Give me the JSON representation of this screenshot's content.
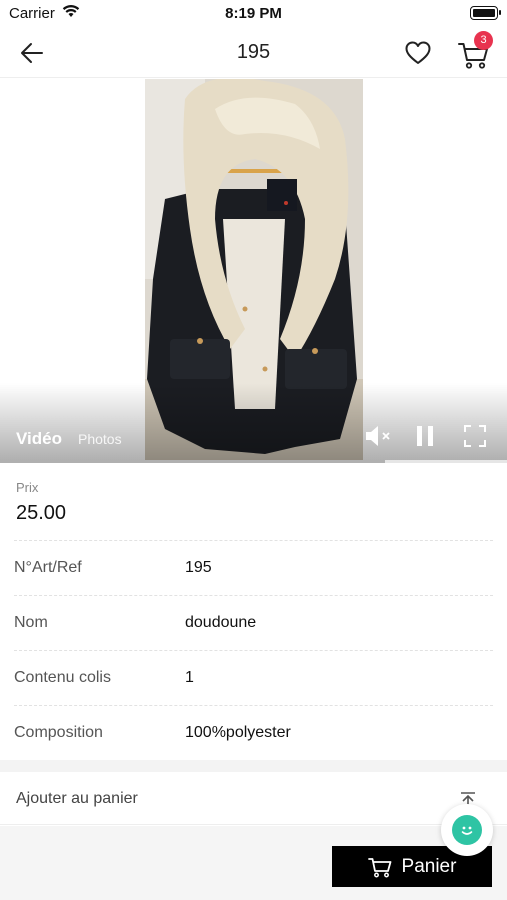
{
  "status_bar": {
    "carrier": "Carrier",
    "time": "8:19 PM"
  },
  "nav": {
    "title": "195",
    "cart_count": "3"
  },
  "media": {
    "tab_video": "Vidéo",
    "tab_photos": "Photos",
    "progress": 0.76
  },
  "price": {
    "label": "Prix",
    "value": "25.00"
  },
  "details": [
    {
      "label": "N°Art/Ref",
      "value": "195"
    },
    {
      "label": "Nom",
      "value": "doudoune"
    },
    {
      "label": "Contenu colis",
      "value": "1"
    },
    {
      "label": "Composition",
      "value": "100%polyester"
    }
  ],
  "actions": {
    "add_to_cart": "Ajouter au panier",
    "panier": "Panier"
  },
  "colors": {
    "badge": "#e8334f",
    "chat": "#2ec4a4",
    "primary_button": "#000000"
  },
  "icons": [
    "wifi-icon",
    "battery-icon",
    "back-arrow-icon",
    "heart-icon",
    "cart-icon",
    "mute-icon",
    "pause-icon",
    "fullscreen-icon",
    "scroll-top-icon",
    "chat-icon"
  ]
}
